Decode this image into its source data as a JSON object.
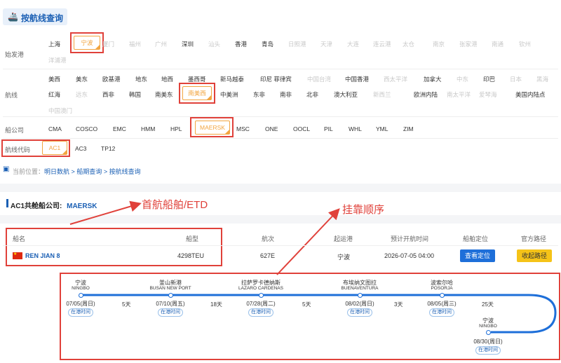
{
  "header": {
    "title": "按航线查询"
  },
  "origin": {
    "label": "始发港",
    "row1": [
      {
        "t": "上海",
        "d": false
      },
      {
        "t": "宁波",
        "d": false,
        "sel": true
      },
      {
        "t": "厦门",
        "d": true
      },
      {
        "t": "福州",
        "d": true
      },
      {
        "t": "广州",
        "d": true
      },
      {
        "t": "深圳",
        "d": false
      },
      {
        "t": "汕头",
        "d": true
      },
      {
        "t": "香港",
        "d": false
      },
      {
        "t": "青岛",
        "d": false
      },
      {
        "t": "日照港",
        "d": true
      },
      {
        "t": "天津",
        "d": true
      },
      {
        "t": "大连",
        "d": true
      },
      {
        "t": "连云港",
        "d": true
      },
      {
        "t": "太仓",
        "d": true
      },
      {
        "t": "南京",
        "d": true
      },
      {
        "t": "张家港",
        "d": true
      },
      {
        "t": "南通",
        "d": true
      },
      {
        "t": "钦州",
        "d": true
      }
    ],
    "row2": [
      {
        "t": "洋浦港",
        "d": true
      }
    ]
  },
  "route": {
    "label": "航线",
    "row1": [
      {
        "t": "美西",
        "d": false
      },
      {
        "t": "美东",
        "d": false
      },
      {
        "t": "欧基港",
        "d": false
      },
      {
        "t": "地东",
        "d": false
      },
      {
        "t": "地西",
        "d": false
      },
      {
        "t": "墨西哥",
        "d": false
      },
      {
        "t": "新马越泰",
        "d": false
      },
      {
        "t": "印尼 菲律宾",
        "d": false
      },
      {
        "t": "中国台湾",
        "d": true
      },
      {
        "t": "中国香港",
        "d": false
      },
      {
        "t": "西太平洋",
        "d": true
      },
      {
        "t": "加拿大",
        "d": false
      },
      {
        "t": "中东",
        "d": true
      },
      {
        "t": "印巴",
        "d": false
      },
      {
        "t": "日本",
        "d": true
      },
      {
        "t": "黑海",
        "d": true
      }
    ],
    "row2": [
      {
        "t": "红海",
        "d": false
      },
      {
        "t": "远东",
        "d": true
      },
      {
        "t": "西非",
        "d": false
      },
      {
        "t": "韩国",
        "d": false
      },
      {
        "t": "南美东",
        "d": false
      },
      {
        "t": "南美西",
        "d": false,
        "sel": true
      },
      {
        "t": "中美洲",
        "d": false
      },
      {
        "t": "东非",
        "d": false
      },
      {
        "t": "南非",
        "d": false
      },
      {
        "t": "北非",
        "d": false
      },
      {
        "t": "澳大利亚",
        "d": false
      },
      {
        "t": "新西兰",
        "d": true
      },
      {
        "t": "欧洲内陆",
        "d": false
      },
      {
        "t": "南太平洋",
        "d": true
      },
      {
        "t": "爱琴海",
        "d": true
      },
      {
        "t": "美国内陆点",
        "d": false
      }
    ],
    "row3": [
      {
        "t": "中国澳门",
        "d": true
      }
    ]
  },
  "carrier": {
    "label": "船公司",
    "items": [
      "CMA",
      "COSCO",
      "EMC",
      "HMM",
      "HPL",
      "MAERSK",
      "MSC",
      "ONE",
      "OOCL",
      "PIL",
      "WHL",
      "YML",
      "ZIM"
    ],
    "selected": "MAERSK"
  },
  "route_code": {
    "label": "航线代码",
    "items": [
      "AC1",
      "AC3",
      "TP12"
    ],
    "selected": "AC1"
  },
  "breadcrumb": {
    "prefix": "当前位置：",
    "items": [
      "明日数航",
      "船期查询",
      "按航线查询"
    ],
    "sep": ">"
  },
  "section": {
    "title": "AC1共舱船公司:",
    "carrier": "MAERSK"
  },
  "annotations": {
    "first_vessel": "首航船舶/ETD",
    "call_order": "挂靠顺序"
  },
  "table": {
    "headers": [
      "船名",
      "船型",
      "航次",
      "起运港",
      "预计开航时间",
      "船舶定位",
      "官方路径"
    ],
    "row": {
      "vessel": "REN JIAN 8",
      "type": "4298TEU",
      "voyage": "627E",
      "port": "宁波",
      "etd": "2026-07-05 04:00",
      "locate_btn": "查看定位",
      "route_btn": "收起路径"
    }
  },
  "route_path": {
    "tag": "在港时间",
    "ports": [
      {
        "cn": "宁波",
        "en": "NINGBO",
        "date": "07/05(周日)"
      },
      {
        "cn": "釜山新港",
        "en": "BUSAN NEW PORT",
        "date": "07/10(周五)"
      },
      {
        "cn": "拉萨罗卡德纳斯",
        "en": "LAZARO CARDENAS",
        "date": "07/28(周二)"
      },
      {
        "cn": "布埃纳文图拉",
        "en": "BUENAVENTURA",
        "date": "08/02(周日)"
      },
      {
        "cn": "波索尔哈",
        "en": "POSORJA",
        "date": "08/05(周三)"
      },
      {
        "cn": "宁波",
        "en": "NINGBO",
        "date": "08/30(周日)"
      }
    ],
    "durations": [
      "5天",
      "18天",
      "5天",
      "3天",
      "25天"
    ]
  },
  "colors": {
    "accent": "#1a5fb4",
    "highlight": "#f2a540",
    "annotation": "#e0413a",
    "route_line": "#1e6fd9",
    "locate_btn": "#1e6fd9",
    "route_btn": "#f5c318"
  }
}
